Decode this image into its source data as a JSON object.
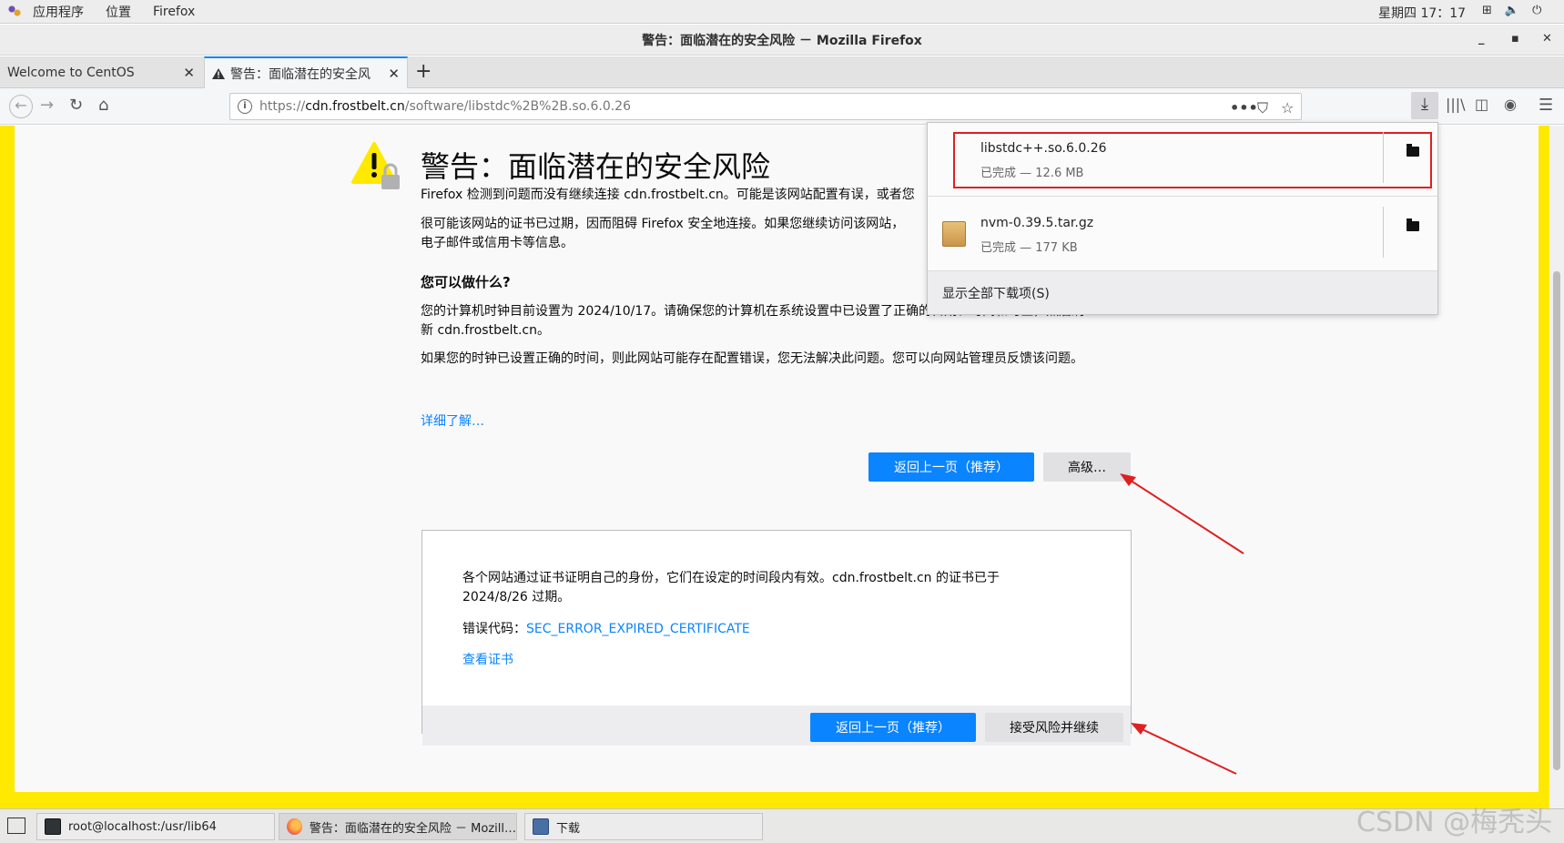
{
  "gnome_bar": {
    "menu": [
      "应用程序",
      "位置",
      "Firefox"
    ],
    "clock": "星期四 17：17"
  },
  "window": {
    "title": "警告：面临潜在的安全风险 － Mozilla Firefox"
  },
  "tabs": [
    {
      "label": "Welcome to CentOS",
      "active": false
    },
    {
      "label": "警告：面临潜在的安全风",
      "active": true
    }
  ],
  "navbar": {
    "url_scheme": "https://",
    "url_host": "cdn.frostbelt.cn",
    "url_path": "/software/libstdc%2B%2B.so.6.0.26"
  },
  "warning_page": {
    "title": "警告：面临潜在的安全风险",
    "para1": "Firefox 检测到问题而没有继续连接 cdn.frostbelt.cn。可能是该网站配置有误，或者您",
    "para2_line1": "很可能该网站的证书已过期，因而阻碍 Firefox 安全地连接。如果您继续访问该网站，",
    "para2_line2": "电子邮件或信用卡等信息。",
    "what_heading": "您可以做什么?",
    "para3_line1": "您的计算机时钟目前设置为 2024/10/17。请确保您的计算机在系统设置中已设置了正确的日期、时间和时区，然后刷",
    "para3_line2": "新 cdn.frostbelt.cn。",
    "para4": "如果您的时钟已设置正确的时间，则此网站可能存在配置错误，您无法解决此问题。您可以向网站管理员反馈该问题。",
    "learn_more": "详细了解…",
    "go_back_label": "返回上一页（推荐）",
    "advanced_label": "高级…"
  },
  "advanced_panel": {
    "text_line1": "各个网站通过证书证明自己的身份，它们在设定的时间段内有效。cdn.frostbelt.cn 的证书已于",
    "text_line2": "2024/8/26 过期。",
    "error_code_label": "错误代码：",
    "error_code": "SEC_ERROR_EXPIRED_CERTIFICATE",
    "view_cert": "查看证书",
    "go_back_label": "返回上一页（推荐）",
    "accept_label": "接受风险并继续"
  },
  "downloads": {
    "items": [
      {
        "name": "libstdc++.so.6.0.26",
        "status": "已完成 — 12.6 MB"
      },
      {
        "name": "nvm-0.39.5.tar.gz",
        "status": "已完成 — 177 KB"
      }
    ],
    "show_all": "显示全部下载项(S)"
  },
  "taskbar": {
    "items": [
      {
        "label": "root@localhost:/usr/lib64"
      },
      {
        "label": "警告：面临潜在的安全风险 － Mozill…"
      },
      {
        "label": "下载"
      }
    ]
  },
  "watermark": "CSDN @梅秃头",
  "colors": {
    "accent": "#0a84ff",
    "warning_border": "#ffe900",
    "annotation_red": "#e02020"
  }
}
